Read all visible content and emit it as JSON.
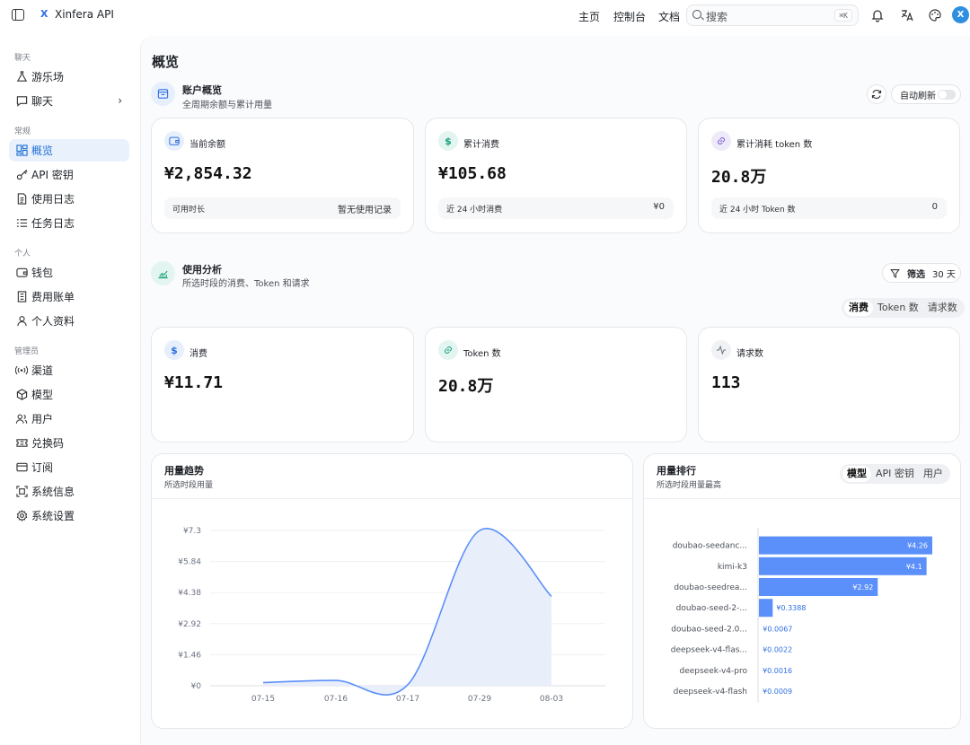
{
  "app": {
    "brand_mark": "X",
    "brand_name": "Xinfera API"
  },
  "topnav": {
    "links": [
      "主页",
      "控制台",
      "文档"
    ],
    "search_placeholder": "搜索",
    "search_shortcut": "⌘K",
    "avatar_letter": "X"
  },
  "sidebar": {
    "groups": [
      "聊天",
      "常规",
      "个人",
      "管理员"
    ],
    "items": [
      {
        "label": "游乐场",
        "icon": "flask-icon"
      },
      {
        "label": "聊天",
        "icon": "chat-icon"
      },
      {
        "label": "概览",
        "icon": "dashboard-icon"
      },
      {
        "label": "API 密钥",
        "icon": "key-icon"
      },
      {
        "label": "使用日志",
        "icon": "log-icon"
      },
      {
        "label": "任务日志",
        "icon": "tasklist-icon"
      },
      {
        "label": "钱包",
        "icon": "wallet-icon"
      },
      {
        "label": "费用账单",
        "icon": "bill-icon"
      },
      {
        "label": "个人资料",
        "icon": "user-icon"
      },
      {
        "label": "渠道",
        "icon": "broadcast-icon"
      },
      {
        "label": "模型",
        "icon": "cube-icon"
      },
      {
        "label": "用户",
        "icon": "users-icon"
      },
      {
        "label": "兑换码",
        "icon": "ticket-icon"
      },
      {
        "label": "订阅",
        "icon": "card-icon"
      },
      {
        "label": "系统信息",
        "icon": "sysinfo-icon"
      },
      {
        "label": "系统设置",
        "icon": "settings-icon"
      }
    ]
  },
  "page": {
    "title": "概览"
  },
  "account": {
    "title": "账户概览",
    "subtitle": "全周期余额与累计用量",
    "auto_refresh_label": "自动刷新",
    "auto_refresh_on": false,
    "cards": [
      {
        "label": "当前余额",
        "value": "¥2,854.32",
        "foot_label": "可用时长",
        "foot_value": "暂无使用记录"
      },
      {
        "label": "累计消费",
        "value": "¥105.68",
        "foot_label": "近 24 小时消费",
        "foot_value": "¥0"
      },
      {
        "label": "累计消耗 token 数",
        "value": "20.8万",
        "foot_label": "近 24 小时 Token 数",
        "foot_value": "0"
      }
    ]
  },
  "analysis": {
    "title": "使用分析",
    "subtitle": "所选时段的消费、Token 和请求",
    "filter_label": "筛选",
    "filter_value": "30 天",
    "tabs": [
      "消费",
      "Token 数",
      "请求数"
    ],
    "selected_tab": "消费",
    "cards": [
      {
        "label": "消费",
        "value": "¥11.71"
      },
      {
        "label": "Token 数",
        "value": "20.8万"
      },
      {
        "label": "请求数",
        "value": "113"
      }
    ]
  },
  "trend": {
    "title": "用量趋势",
    "subtitle": "所选时段用量"
  },
  "ranking": {
    "title": "用量排行",
    "subtitle": "所选时段用量最高",
    "tabs": [
      "模型",
      "API 密钥",
      "用户"
    ],
    "selected_tab": "模型"
  },
  "chart_data": [
    {
      "type": "area",
      "x": [
        "07-15",
        "07-16",
        "07-17",
        "07-29",
        "08-03"
      ],
      "values": [
        0.15,
        0.25,
        0.05,
        7.3,
        4.2
      ],
      "ytick_labels": [
        "¥0",
        "¥1.46",
        "¥2.92",
        "¥4.38",
        "¥5.84",
        "¥7.3"
      ],
      "ylim": [
        0,
        7.3
      ],
      "color": "#5b8ff9",
      "fill": "#e9eefb",
      "grid": true
    },
    {
      "type": "bar",
      "orientation": "horizontal",
      "categories": [
        "doubao-seedanc...",
        "kimi-k3",
        "doubao-seedrea...",
        "doubao-seed-2-...",
        "doubao-seed-2.0...",
        "deepseek-v4-flas...",
        "deepseek-v4-pro",
        "deepseek-v4-flash"
      ],
      "values": [
        4.26,
        4.12,
        2.92,
        0.3388,
        0.0067,
        0.0022,
        0.0016,
        0.0009
      ],
      "value_labels": [
        "¥4.26",
        "¥4.1",
        "¥2.92",
        "¥0.3388",
        "¥0.0067",
        "¥0.0022",
        "¥0.0016",
        "¥0.0009"
      ],
      "color": "#5b8ff9"
    }
  ]
}
